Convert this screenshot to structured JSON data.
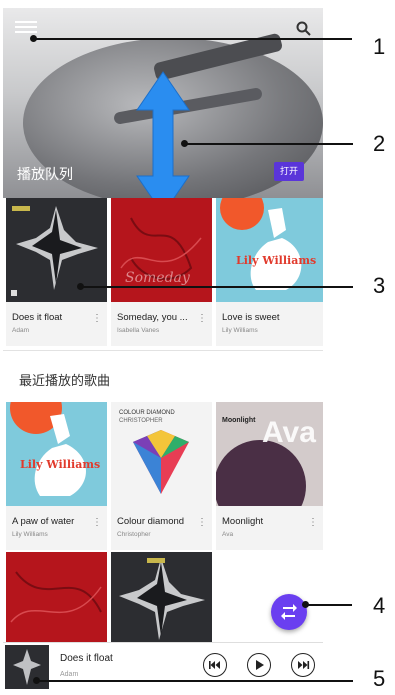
{
  "header": {
    "queue_label": "播放队列",
    "open_button": "打开"
  },
  "queue_items": [
    {
      "title": "Does it float",
      "artist": "Adam"
    },
    {
      "title": "Someday, you ...",
      "artist": "Isabella Vanes"
    },
    {
      "title": "Love is sweet",
      "artist": "Lily Williams"
    }
  ],
  "recent": {
    "section_title": "最近播放的歌曲",
    "items": [
      {
        "title": "A paw of water",
        "artist": "Lily Williams"
      },
      {
        "title": "Colour diamond",
        "artist": "Christopher"
      },
      {
        "title": "Moonlight",
        "artist": "Ava"
      }
    ]
  },
  "album_text": {
    "lily_williams": "Lily Williams",
    "colour_diamond": "COLOUR DIAMOND",
    "christopher": "CHRISTOPHER",
    "ava": "Ava",
    "moonlight": "Moonlight"
  },
  "now_playing": {
    "title": "Does it float",
    "artist": "Adam"
  },
  "callouts": [
    "1",
    "2",
    "3",
    "4",
    "5"
  ],
  "colors": {
    "accent": "#5a35d9",
    "fab": "#6a3ff0"
  },
  "icons": [
    "menu-icon",
    "search-icon",
    "resize-arrow-icon",
    "more-icon",
    "shuffle-icon",
    "previous-icon",
    "play-icon",
    "next-icon"
  ]
}
